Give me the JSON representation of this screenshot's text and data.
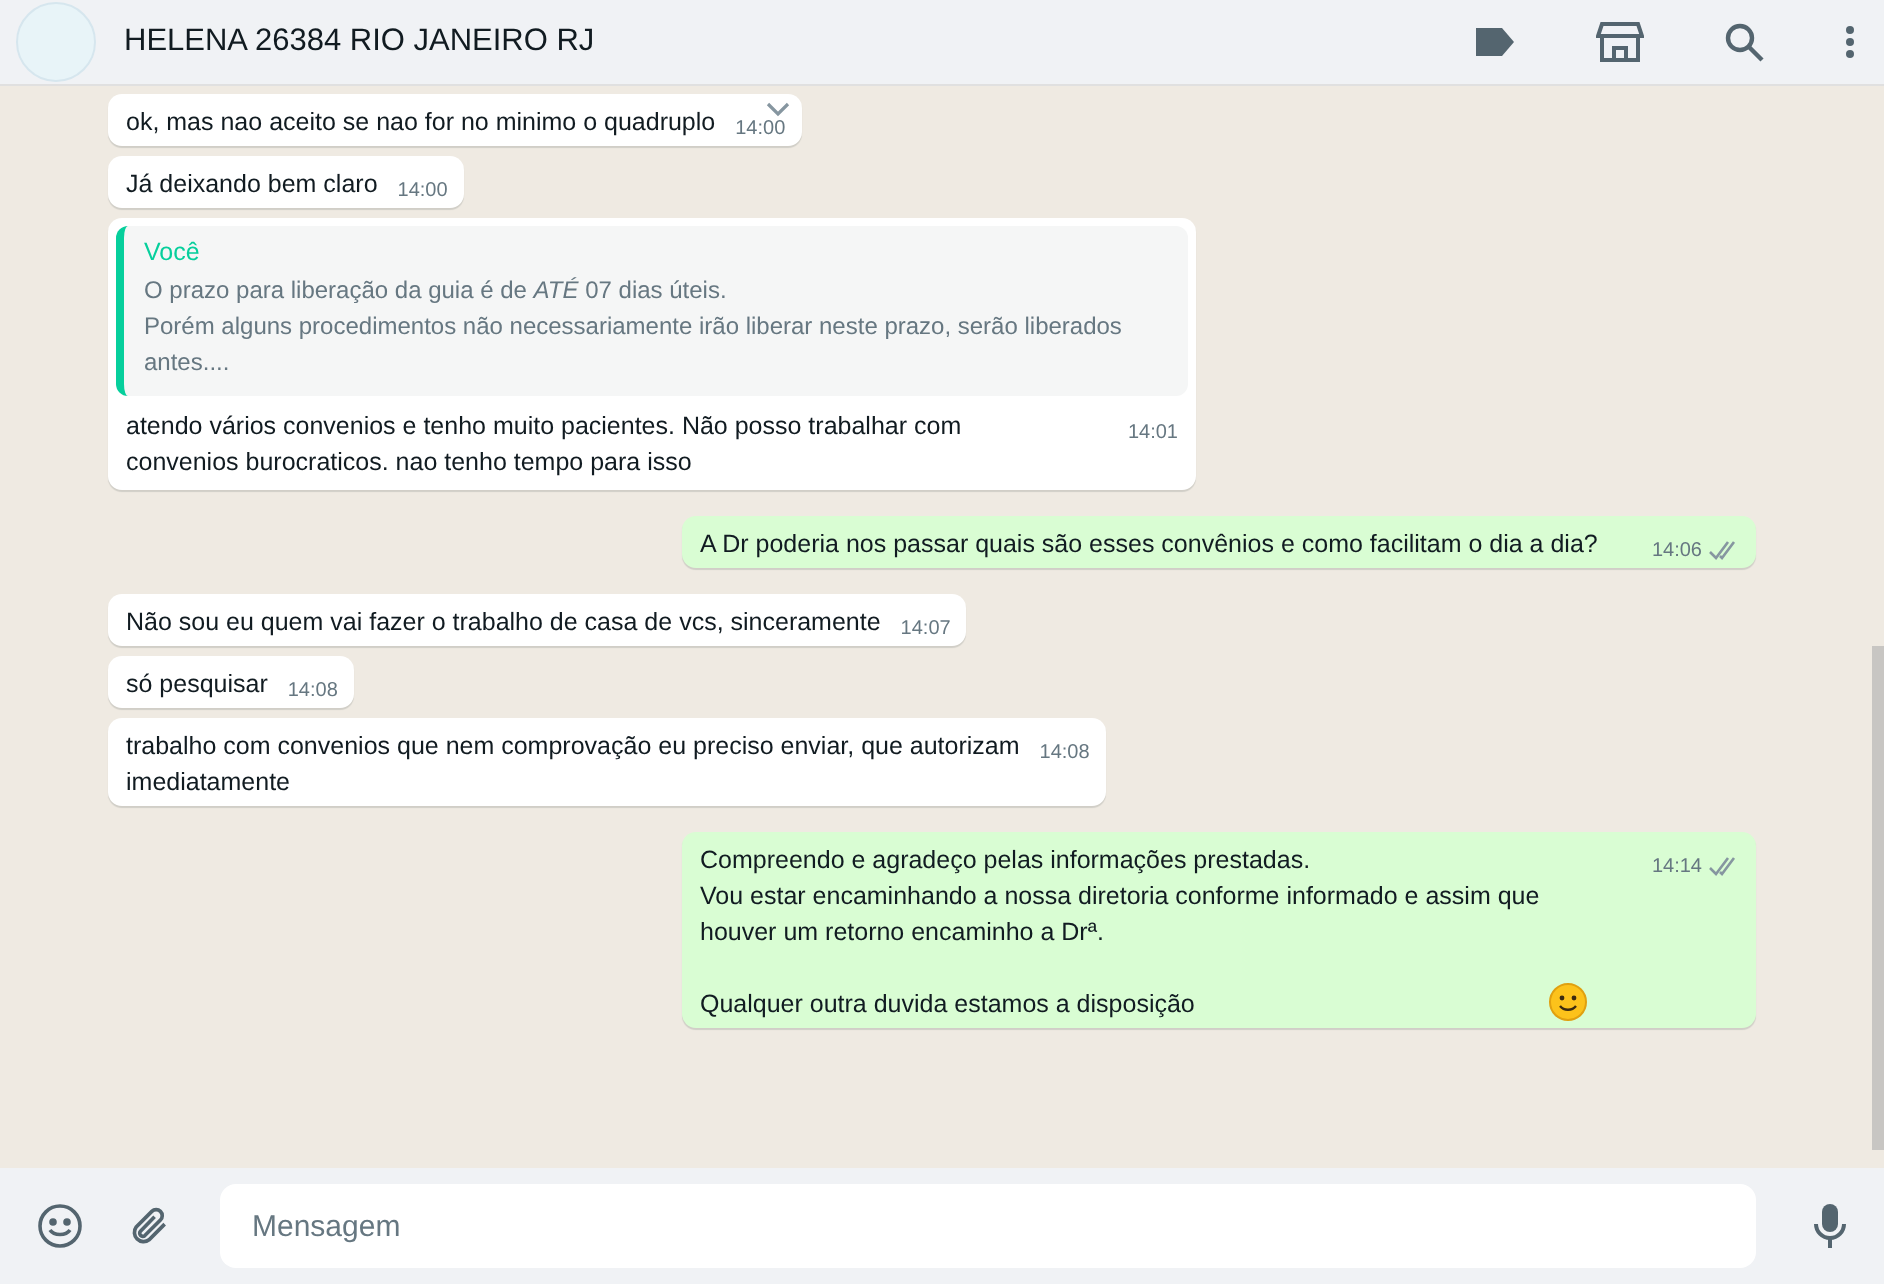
{
  "header": {
    "title": "HELENA 26384 RIO JANEIRO RJ"
  },
  "messages": [
    {
      "outgoing": false,
      "text": "ok, mas nao aceito se nao for no minimo o quadruplo",
      "time": "14:00",
      "menu_visible": true
    },
    {
      "outgoing": false,
      "text": "Já deixando bem claro",
      "time": "14:00",
      "menu_visible": false
    },
    {
      "outgoing": false,
      "quote": {
        "author": "Você",
        "lines": [
          "O prazo para liberação da guia é de *ATÉ* 07 dias úteis.",
          "Porém alguns procedimentos não necessariamente irão liberar neste prazo, serão liberados antes...."
        ]
      },
      "text": "atendo vários convenios e tenho muito pacientes. Não posso trabalhar com\nconvenios burocraticos. nao tenho tempo para isso",
      "time": "14:01",
      "menu_visible": false
    },
    {
      "outgoing": true,
      "text": "A Dr poderia nos passar quais são esses convênios e como facilitam o dia a dia?",
      "time": "14:06",
      "read": false,
      "smiley": false
    },
    {
      "outgoing": false,
      "text": "Não sou eu quem vai fazer o trabalho de casa de vcs, sinceramente",
      "time": "14:07",
      "menu_visible": false
    },
    {
      "outgoing": false,
      "text": "só pesquisar",
      "time": "14:08",
      "menu_visible": false
    },
    {
      "outgoing": false,
      "text": "trabalho com convenios que nem comprovação eu preciso enviar, que autorizam\nimediatamente",
      "time": "14:08",
      "menu_visible": false
    },
    {
      "outgoing": true,
      "text": "Compreendo e agradeço pelas informações prestadas.\nVou estar encaminhando a nossa diretoria conforme informado e assim que\nhouver um retorno encaminho a Drª.\n\nQualquer outra duvida estamos a disposição",
      "time": "14:14",
      "read": false,
      "smiley": true
    }
  ],
  "composer": {
    "placeholder": "Mensagem"
  }
}
